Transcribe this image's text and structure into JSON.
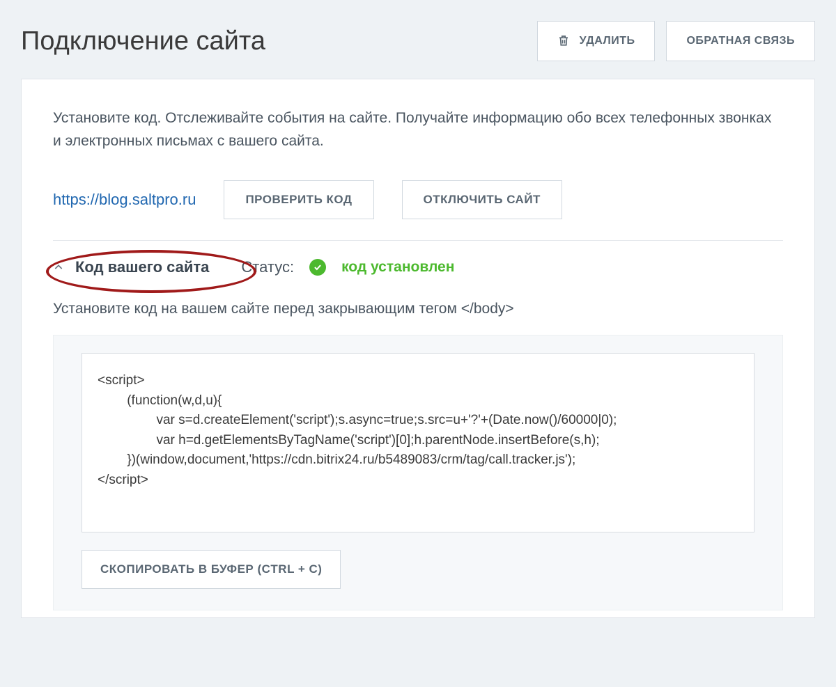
{
  "header": {
    "title": "Подключение сайта",
    "delete_label": "УДАЛИТЬ",
    "feedback_label": "ОБРАТНАЯ СВЯЗЬ"
  },
  "intro_text": "Установите код. Отслеживайте события на сайте. Получайте информацию обо всех телефонных звонках и электронных письмах с вашего сайта.",
  "site_url": "https://blog.saltpro.ru",
  "buttons": {
    "check_code": "ПРОВЕРИТЬ КОД",
    "disconnect_site": "ОТКЛЮЧИТЬ САЙТ",
    "copy_buffer": "СКОПИРОВАТЬ В БУФЕР (CTRL + C)"
  },
  "section": {
    "title": "Код вашего сайта",
    "status_label": "Статус:",
    "status_text": "код установлен"
  },
  "code_instruction": "Установите код на вашем сайте перед закрывающим тегом </body>",
  "code_snippet": "<script>\n        (function(w,d,u){\n                var s=d.createElement('script');s.async=true;s.src=u+'?'+(Date.now()/60000|0);\n                var h=d.getElementsByTagName('script')[0];h.parentNode.insertBefore(s,h);\n        })(window,document,'https://cdn.bitrix24.ru/b5489083/crm/tag/call.tracker.js');\n</script>"
}
